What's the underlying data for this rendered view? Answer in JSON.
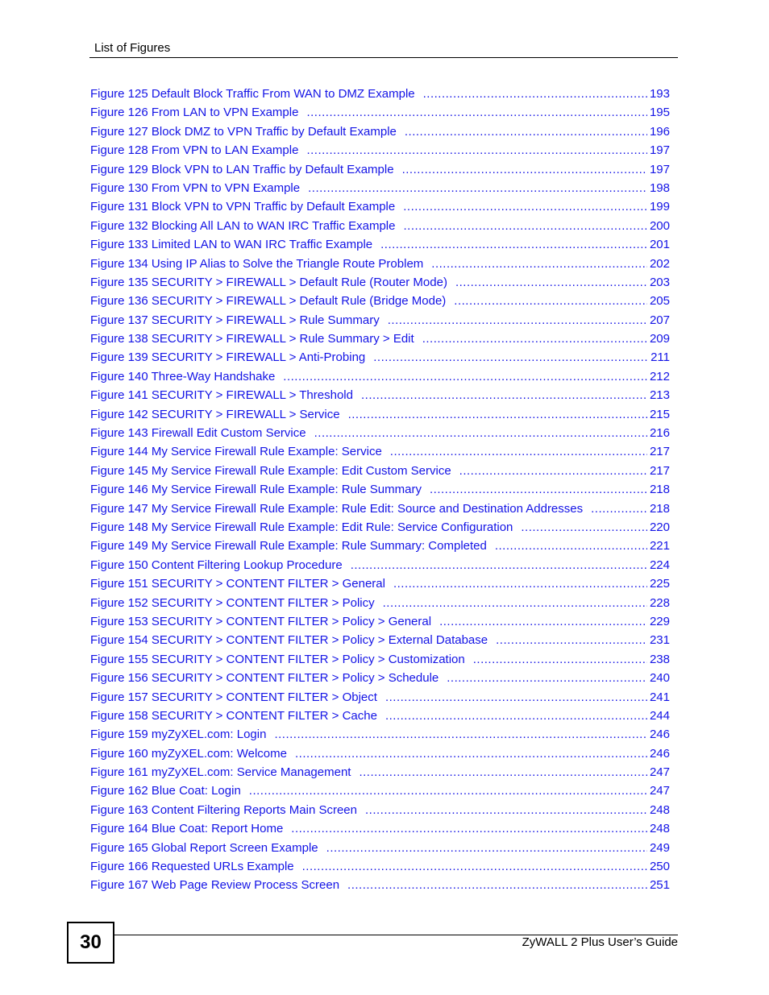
{
  "header": {
    "title": "List of Figures"
  },
  "colors": {
    "link": "#1414e6",
    "text": "#000000"
  },
  "entries": [
    {
      "title": "Figure 125 Default Block Traffic From WAN to DMZ Example",
      "page": "193"
    },
    {
      "title": "Figure 126 From LAN to VPN Example",
      "page": "195"
    },
    {
      "title": "Figure 127 Block DMZ to VPN Traffic by Default Example",
      "page": "196"
    },
    {
      "title": "Figure 128 From VPN to LAN Example",
      "page": "197"
    },
    {
      "title": "Figure 129 Block VPN to LAN Traffic by Default Example",
      "page": "197"
    },
    {
      "title": "Figure 130 From VPN to VPN Example",
      "page": "198"
    },
    {
      "title": "Figure 131 Block VPN to VPN Traffic by Default Example",
      "page": "199"
    },
    {
      "title": "Figure 132 Blocking All LAN to WAN IRC Traffic Example",
      "page": "200"
    },
    {
      "title": "Figure 133 Limited LAN to WAN IRC Traffic Example",
      "page": "201"
    },
    {
      "title": "Figure 134 Using IP Alias to Solve the Triangle Route Problem",
      "page": "202"
    },
    {
      "title": "Figure 135 SECURITY > FIREWALL > Default Rule (Router Mode)",
      "page": "203"
    },
    {
      "title": "Figure 136 SECURITY > FIREWALL > Default Rule (Bridge Mode)",
      "page": "205"
    },
    {
      "title": "Figure 137 SECURITY > FIREWALL > Rule Summary",
      "page": "207"
    },
    {
      "title": "Figure 138 SECURITY > FIREWALL > Rule Summary > Edit",
      "page": "209"
    },
    {
      "title": "Figure 139 SECURITY > FIREWALL > Anti-Probing",
      "page": "211"
    },
    {
      "title": "Figure 140 Three-Way Handshake",
      "page": "212"
    },
    {
      "title": "Figure 141 SECURITY > FIREWALL > Threshold",
      "page": "213"
    },
    {
      "title": "Figure 142 SECURITY > FIREWALL > Service",
      "page": "215"
    },
    {
      "title": "Figure 143 Firewall Edit Custom Service",
      "page": "216"
    },
    {
      "title": "Figure 144 My Service Firewall Rule Example: Service",
      "page": "217"
    },
    {
      "title": "Figure 145 My Service Firewall Rule Example: Edit Custom Service",
      "page": "217"
    },
    {
      "title": "Figure 146 My Service Firewall Rule Example: Rule Summary",
      "page": "218"
    },
    {
      "title": "Figure 147 My Service Firewall Rule Example: Rule Edit: Source and Destination Addresses",
      "page": "218"
    },
    {
      "title": "Figure 148 My Service Firewall Rule Example: Edit Rule: Service Configuration",
      "page": "220"
    },
    {
      "title": "Figure 149 My Service Firewall Rule Example: Rule Summary: Completed",
      "page": "221"
    },
    {
      "title": "Figure 150 Content Filtering Lookup Procedure",
      "page": "224"
    },
    {
      "title": "Figure 151 SECURITY > CONTENT FILTER > General",
      "page": "225"
    },
    {
      "title": "Figure 152 SECURITY > CONTENT FILTER > Policy",
      "page": "228"
    },
    {
      "title": "Figure 153 SECURITY > CONTENT FILTER > Policy > General",
      "page": "229"
    },
    {
      "title": "Figure 154 SECURITY > CONTENT FILTER > Policy > External Database",
      "page": "231"
    },
    {
      "title": "Figure 155 SECURITY > CONTENT FILTER > Policy > Customization",
      "page": "238"
    },
    {
      "title": "Figure 156 SECURITY > CONTENT FILTER > Policy > Schedule",
      "page": "240"
    },
    {
      "title": "Figure 157 SECURITY > CONTENT FILTER > Object",
      "page": "241"
    },
    {
      "title": "Figure 158 SECURITY > CONTENT FILTER > Cache",
      "page": "244"
    },
    {
      "title": "Figure 159 myZyXEL.com: Login",
      "page": "246"
    },
    {
      "title": "Figure 160 myZyXEL.com: Welcome",
      "page": "246"
    },
    {
      "title": "Figure 161 myZyXEL.com: Service Management",
      "page": "247"
    },
    {
      "title": "Figure 162 Blue Coat: Login",
      "page": "247"
    },
    {
      "title": "Figure 163 Content Filtering Reports Main Screen",
      "page": "248"
    },
    {
      "title": "Figure 164 Blue Coat: Report Home",
      "page": "248"
    },
    {
      "title": "Figure 165 Global Report Screen Example",
      "page": "249"
    },
    {
      "title": "Figure 166 Requested URLs Example",
      "page": "250"
    },
    {
      "title": "Figure 167 Web Page Review Process Screen",
      "page": "251"
    }
  ],
  "footer": {
    "page_number": "30",
    "guide_title": "ZyWALL 2 Plus User’s Guide"
  }
}
